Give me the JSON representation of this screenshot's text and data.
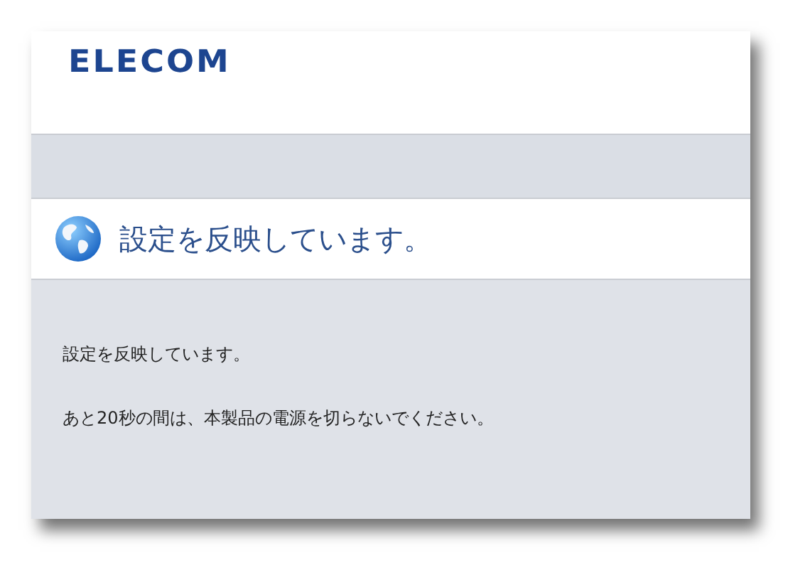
{
  "header": {
    "logo": "ELECOM"
  },
  "title_bar": {
    "title": "設定を反映しています。"
  },
  "body": {
    "paragraphs": [
      "設定を反映しています。",
      "あと20秒の間は、本製品の電源を切らないでください。"
    ]
  }
}
